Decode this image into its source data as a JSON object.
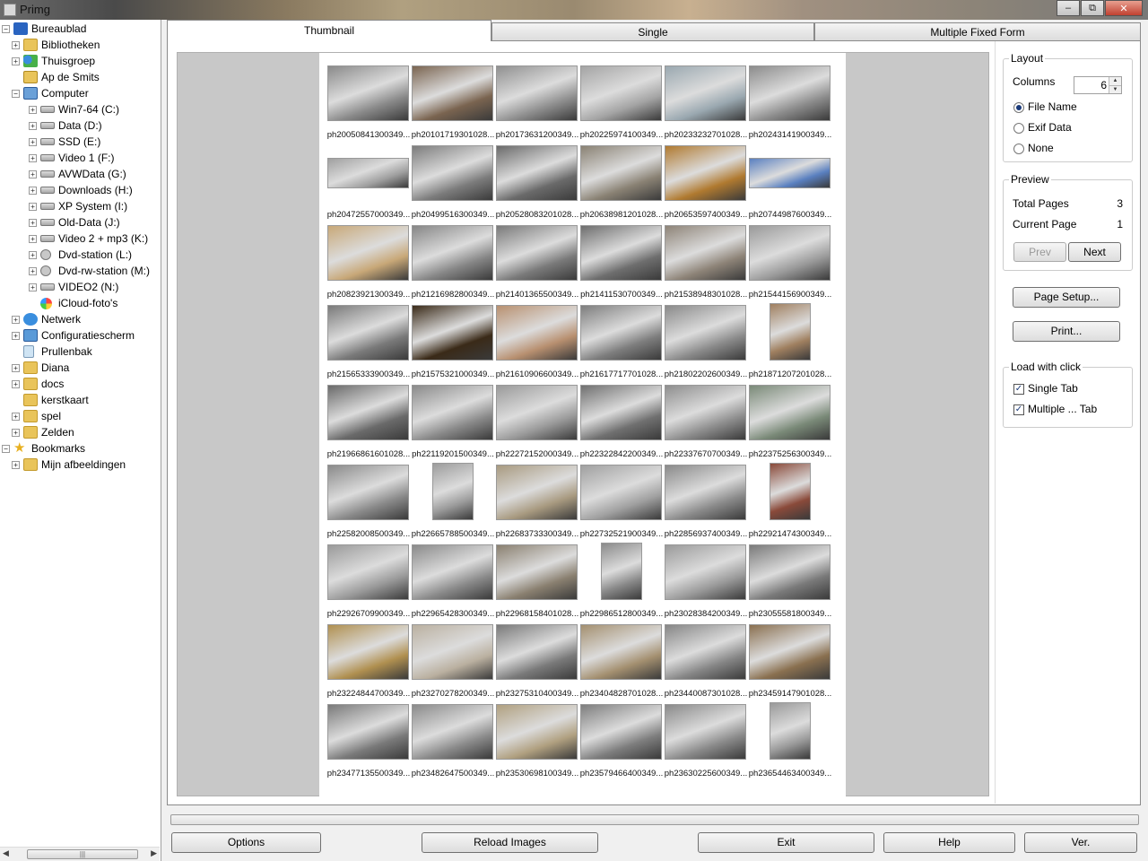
{
  "window": {
    "title": "Primg"
  },
  "tree": [
    {
      "label": "Bureaublad",
      "level": 0,
      "icon": "desktop",
      "expander": "minus"
    },
    {
      "label": "Bibliotheken",
      "level": 1,
      "icon": "folder",
      "expander": "plus"
    },
    {
      "label": "Thuisgroep",
      "level": 1,
      "icon": "group",
      "expander": "plus"
    },
    {
      "label": "Ap de Smits",
      "level": 1,
      "icon": "user",
      "expander": "none"
    },
    {
      "label": "Computer",
      "level": 1,
      "icon": "computer",
      "expander": "minus"
    },
    {
      "label": "Win7-64 (C:)",
      "level": 2,
      "icon": "drive",
      "expander": "plus"
    },
    {
      "label": "Data (D:)",
      "level": 2,
      "icon": "drive",
      "expander": "plus"
    },
    {
      "label": "SSD (E:)",
      "level": 2,
      "icon": "drive",
      "expander": "plus"
    },
    {
      "label": "Video 1 (F:)",
      "level": 2,
      "icon": "drive",
      "expander": "plus"
    },
    {
      "label": "AVWData (G:)",
      "level": 2,
      "icon": "drive",
      "expander": "plus"
    },
    {
      "label": "Downloads (H:)",
      "level": 2,
      "icon": "drive",
      "expander": "plus"
    },
    {
      "label": "XP System (I:)",
      "level": 2,
      "icon": "drive",
      "expander": "plus"
    },
    {
      "label": "Old-Data (J:)",
      "level": 2,
      "icon": "drive",
      "expander": "plus"
    },
    {
      "label": "Video 2 + mp3 (K:)",
      "level": 2,
      "icon": "drive",
      "expander": "plus"
    },
    {
      "label": "Dvd-station (L:)",
      "level": 2,
      "icon": "dvd",
      "expander": "plus"
    },
    {
      "label": "Dvd-rw-station (M:)",
      "level": 2,
      "icon": "dvd",
      "expander": "plus"
    },
    {
      "label": "VIDEO2 (N:)",
      "level": 2,
      "icon": "drive",
      "expander": "plus"
    },
    {
      "label": "iCloud-foto's",
      "level": 2,
      "icon": "icloud",
      "expander": "none"
    },
    {
      "label": "Netwerk",
      "level": 1,
      "icon": "network",
      "expander": "plus"
    },
    {
      "label": "Configuratiescherm",
      "level": 1,
      "icon": "control",
      "expander": "plus"
    },
    {
      "label": "Prullenbak",
      "level": 1,
      "icon": "trash",
      "expander": "none"
    },
    {
      "label": "Diana",
      "level": 1,
      "icon": "folder",
      "expander": "plus"
    },
    {
      "label": "docs",
      "level": 1,
      "icon": "folder",
      "expander": "plus"
    },
    {
      "label": "kerstkaart",
      "level": 1,
      "icon": "folder",
      "expander": "none"
    },
    {
      "label": "spel",
      "level": 1,
      "icon": "folder",
      "expander": "plus"
    },
    {
      "label": "Zelden",
      "level": 1,
      "icon": "folder",
      "expander": "plus"
    },
    {
      "label": "Bookmarks",
      "level": 0,
      "icon": "star",
      "expander": "minus"
    },
    {
      "label": "Mijn afbeeldingen",
      "level": 1,
      "icon": "folder",
      "expander": "plus"
    }
  ],
  "tabs": [
    "Thumbnail",
    "Single",
    "Multiple Fixed Form"
  ],
  "active_tab": "Thumbnail",
  "thumbnails": [
    "ph20050841300349...",
    "ph20101719301028...",
    "ph20173631200349...",
    "ph20225974100349...",
    "ph20233232701028...",
    "ph20243141900349...",
    "ph20472557000349...",
    "ph20499516300349...",
    "ph20528083201028...",
    "ph20638981201028...",
    "ph20653597400349...",
    "ph20744987600349...",
    "ph20823921300349...",
    "ph21216982800349...",
    "ph21401365500349...",
    "ph21411530700349...",
    "ph21538948301028...",
    "ph21544156900349...",
    "ph21565333900349...",
    "ph21575321000349...",
    "ph21610906600349...",
    "ph21617717701028...",
    "ph21802202600349...",
    "ph21871207201028...",
    "ph21966861601028...",
    "ph22119201500349...",
    "ph22272152000349...",
    "ph22322842200349...",
    "ph22337670700349...",
    "ph22375256300349...",
    "ph22582008500349...",
    "ph22665788500349...",
    "ph22683733300349...",
    "ph22732521900349...",
    "ph22856937400349...",
    "ph22921474300349...",
    "ph22926709900349...",
    "ph22965428300349...",
    "ph22968158401028...",
    "ph22986512800349...",
    "ph23028384200349...",
    "ph23055581800349...",
    "ph23224844700349...",
    "ph23270278200349...",
    "ph23275310400349...",
    "ph23404828701028...",
    "ph23440087301028...",
    "ph23459147901028...",
    "ph23477135500349...",
    "ph23482647500349...",
    "ph23530698100349...",
    "ph23579466400349...",
    "ph23630225600349...",
    "ph23654463400349..."
  ],
  "thumb_shapes": [
    "land",
    "land",
    "land",
    "land",
    "land",
    "land",
    "pan",
    "land",
    "land",
    "land",
    "land",
    "pan",
    "land",
    "land",
    "land",
    "land",
    "land",
    "land",
    "land",
    "land",
    "land",
    "land",
    "land",
    "port",
    "land",
    "land",
    "land",
    "land",
    "land",
    "land",
    "land",
    "port",
    "land",
    "land",
    "land",
    "port",
    "land",
    "land",
    "land",
    "port",
    "land",
    "land",
    "land",
    "land",
    "land",
    "land",
    "land",
    "land",
    "land",
    "land",
    "land",
    "land",
    "land",
    "port"
  ],
  "thumb_colors": [
    "#8a8a8a",
    "#7a6450",
    "#909090",
    "#a4a4a4",
    "#9aa8b0",
    "#8c8c8c",
    "#a0a0a0",
    "#7c7c7c",
    "#6a6a6a",
    "#8a8274",
    "#b07a30",
    "#5a80c0",
    "#c8a878",
    "#868686",
    "#7a7a7a",
    "#6e6e6e",
    "#8e8478",
    "#9a9a9a",
    "#7a7a7a",
    "#3a2a18",
    "#b89070",
    "#7e7e7e",
    "#8a8a8a",
    "#a08060",
    "#6a6a6a",
    "#8a8a8a",
    "#9a9a9a",
    "#707070",
    "#8e8e8e",
    "#7a8a78",
    "#8a8a8a",
    "#9c9c9c",
    "#a89a80",
    "#a0a0a0",
    "#8a8a8a",
    "#8a4a3a",
    "#9a9a9a",
    "#8a8a8a",
    "#8a8070",
    "#8a8a8a",
    "#9a9a9a",
    "#7a7a7a",
    "#b09050",
    "#bab0a0",
    "#7a7a7a",
    "#a49070",
    "#868686",
    "#8a7050",
    "#7a7a7a",
    "#8a8a8a",
    "#b0a080",
    "#7e7e7e",
    "#8a8a8a",
    "#9a9a9a"
  ],
  "options": {
    "layout_title": "Layout",
    "columns_label": "Columns",
    "columns_value": "6",
    "radio_filename": "File Name",
    "radio_exif": "Exif Data",
    "radio_none": "None",
    "selected_label_mode": "File Name",
    "preview_title": "Preview",
    "total_pages_label": "Total Pages",
    "total_pages_value": "3",
    "current_page_label": "Current Page",
    "current_page_value": "1",
    "prev_label": "Prev",
    "next_label": "Next",
    "page_setup_label": "Page Setup...",
    "print_label": "Print...",
    "load_title": "Load with click",
    "single_tab_label": "Single Tab",
    "single_tab_checked": true,
    "multiple_tab_label": "Multiple ... Tab",
    "multiple_tab_checked": true
  },
  "bottom": {
    "options": "Options",
    "reload": "Reload Images",
    "exit": "Exit",
    "help": "Help",
    "version": "Ver."
  }
}
